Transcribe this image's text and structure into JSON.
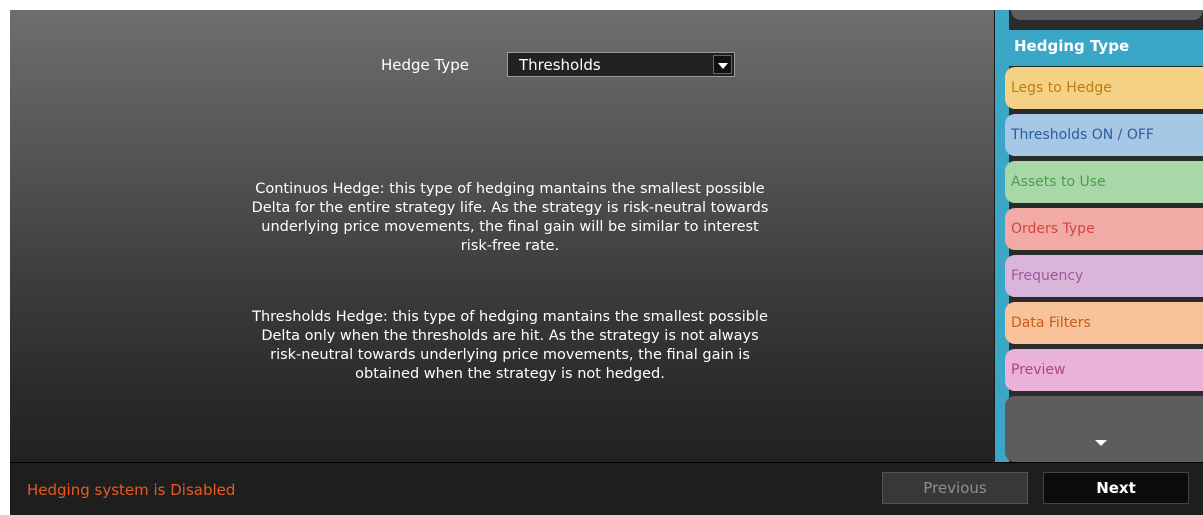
{
  "hedge_type": {
    "label": "Hedge Type",
    "selected": "Thresholds"
  },
  "descriptions": {
    "continuous": "Continuos Hedge: this type of hedging mantains the smallest possible Delta for the entire strategy life. As the strategy is risk-neutral towards underlying price movements, the final gain will be similar to interest risk-free rate.",
    "thresholds": "Thresholds Hedge: this type of hedging mantains the smallest possible Delta only when the thresholds are hit. As the strategy is not always risk-neutral towards underlying price movements, the final gain is obtained when the strategy is not hedged."
  },
  "sidebar": {
    "active": "Hedging Type",
    "items": [
      {
        "label": "Legs to Hedge"
      },
      {
        "label": "Thresholds ON / OFF"
      },
      {
        "label": "Assets to Use"
      },
      {
        "label": "Orders Type"
      },
      {
        "label": "Frequency"
      },
      {
        "label": "Data Filters"
      },
      {
        "label": "Preview"
      }
    ],
    "scroll_icon": "chevron-down-icon"
  },
  "footer": {
    "status": "Hedging system is Disabled",
    "previous_label": "Previous",
    "next_label": "Next"
  },
  "colors": {
    "accent": "#3aa7c7",
    "status": "#e85a1e"
  }
}
